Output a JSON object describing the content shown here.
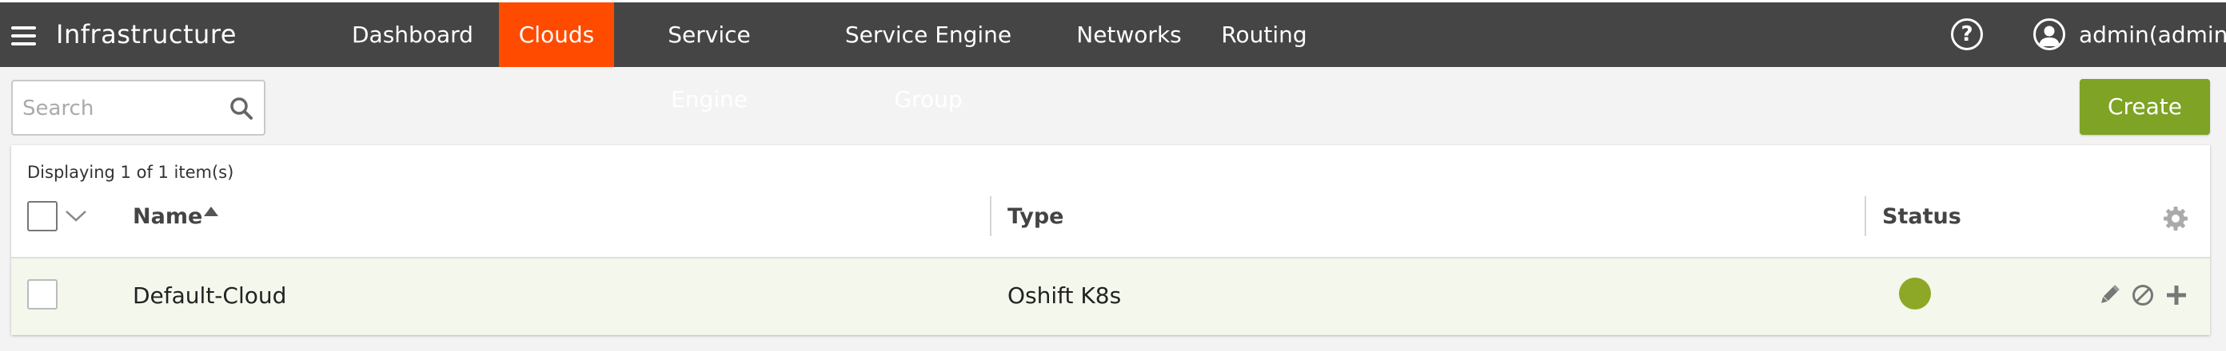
{
  "app": {
    "title": "Infrastructure"
  },
  "nav": {
    "tabs": [
      "Dashboard",
      "Clouds",
      "Service Engine",
      "Service Engine Group",
      "Networks",
      "Routing"
    ],
    "active": "Clouds"
  },
  "header_right": {
    "help_symbol": "?",
    "user_label": "admin(admin)"
  },
  "search": {
    "placeholder": "Search",
    "value": ""
  },
  "toolbar": {
    "create_label": "Create"
  },
  "table": {
    "count_text": "Displaying 1 of 1 item(s)",
    "columns": [
      "Name",
      "Type",
      "Status"
    ],
    "sort": {
      "column": "Name",
      "direction": "ascending"
    },
    "rows": [
      {
        "name": "Default-Cloud",
        "type": "Oshift K8s",
        "status": "green"
      }
    ]
  },
  "colors": {
    "topbar": "#454545",
    "active_tab": "#ff4b00",
    "create_button": "#7ea325",
    "status_ok": "#8ca826",
    "row_bg": "#f4f7ec"
  },
  "icons": [
    "hamburger-menu-icon",
    "help-icon",
    "user-icon",
    "search-icon",
    "chevron-down-icon",
    "sort-asc-icon",
    "gear-icon",
    "edit-icon",
    "disable-icon",
    "add-icon"
  ]
}
